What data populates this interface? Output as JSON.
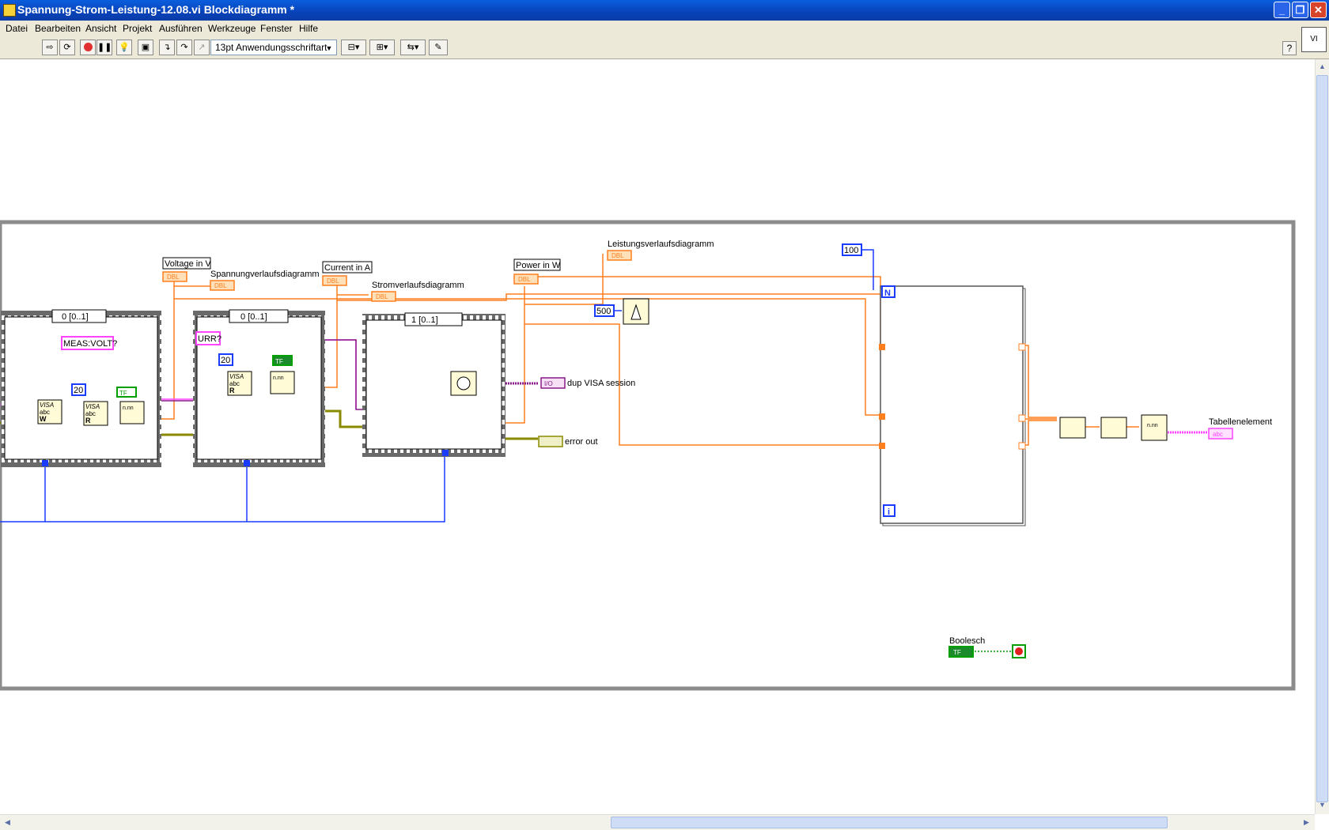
{
  "window": {
    "title": "Spannung-Strom-Leistung-12.08.vi Blockdiagramm *"
  },
  "menu": [
    "Datei",
    "Bearbeiten",
    "Ansicht",
    "Projekt",
    "Ausführen",
    "Werkzeuge",
    "Fenster",
    "Hilfe"
  ],
  "toolbar": {
    "font_select": "13pt Anwendungsschriftart",
    "help_label": "?"
  },
  "diagram": {
    "frame1_selector": "0 [0..1]",
    "frame2_selector": "0 [0..1]",
    "frame3_selector": "1 [0..1]",
    "str_meas_volt": "MEAS:VOLT?",
    "str_curr": "URR?",
    "const_20_a": "20",
    "const_20_b": "20",
    "const_500": "500",
    "const_100": "100",
    "loop_n": "N",
    "loop_i": "i",
    "ind_voltage": "Voltage in V",
    "ind_current": "Current in A",
    "ind_power": "Power in W",
    "chart_voltage": "Spannungverlaufsdiagramm",
    "chart_current": "Stromverlaufsdiagramm",
    "chart_power": "Leistungsverlaufsdiagramm",
    "dbl_tag": "DBL",
    "tf_tag": "TF",
    "io_tag": "I/O",
    "abc_tag": "abc",
    "visa_tag": "VISA",
    "visa_w": "W",
    "visa_r": "R",
    "nnn_tag": "n.nn",
    "dup_visa": "dup VISA session",
    "error_out": "error out",
    "table_element": "Tabellenelement",
    "boolean_label": "Boolesch"
  },
  "colors": {
    "dbl_wire": "#ff7f1f",
    "string_wire": "#ff44ff",
    "int_wire": "#1a3cff",
    "error_wire": "#8a8a00",
    "visa_wire": "#8a1a8a",
    "bool_wire": "#00a000"
  }
}
